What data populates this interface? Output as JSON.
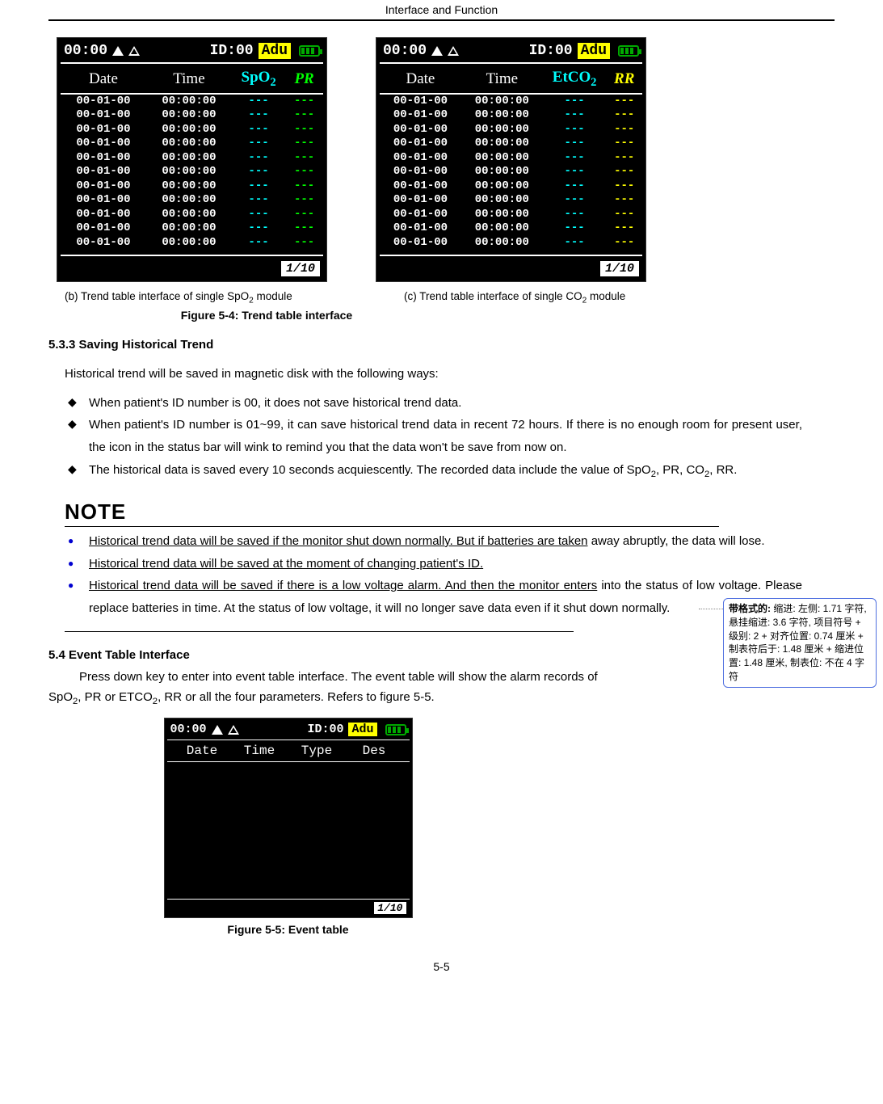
{
  "header": {
    "title": "Interface and Function"
  },
  "monitor_common": {
    "time": "00:00",
    "id_label": "ID:00",
    "adu": "Adu",
    "paging": "1/10",
    "row_date": "00-01-00",
    "row_time": "00:00:00",
    "dash": "---"
  },
  "monitor_left": {
    "headers": {
      "c1": "Date",
      "c2": "Time",
      "c3": "SpO",
      "c3sub": "2",
      "c4": "PR"
    },
    "row_count": 11
  },
  "monitor_right": {
    "headers": {
      "c1": "Date",
      "c2": "Time",
      "c3": "EtCO",
      "c3sub": "2",
      "c4": "RR"
    },
    "row_count": 11
  },
  "captions": {
    "left": "(b) Trend table interface of single SpO",
    "left_sub": "2",
    "left_tail": " module",
    "right": "(c) Trend table interface of single CO",
    "right_sub": "2",
    "right_tail": " module",
    "figure54": "Figure 5-4: Trend table interface"
  },
  "section533": {
    "heading": "5.3.3 Saving Historical Trend",
    "intro": "Historical trend will be saved in magnetic disk with the following ways:",
    "bullets": [
      "When patient's ID number is 00, it does not save historical trend data.",
      "When patient's ID number is 01~99, it can save historical trend data in recent 72 hours. If there is no enough room for present user, the icon in the status bar will wink to remind you that the data won't be save from now on.",
      "The historical data is saved every 10 seconds acquiescently. The recorded data include the value of SpO2, PR, CO2, RR."
    ],
    "note_label": "NOTE",
    "notes": [
      {
        "u": "Historical trend data will be saved if the monitor shut down normally. But if batteries are taken",
        "rest": "away abruptly, the data will lose."
      },
      {
        "u": "Historical trend data will be saved at the moment of changing patient's ID.",
        "rest": ""
      },
      {
        "u": "Historical trend data will be saved if there is a low voltage alarm. And then the monitor enters",
        "rest": "into the status of low voltage. Please replace batteries in time. At the status of low voltage, it will no longer save data even if it shut down normally."
      }
    ]
  },
  "section54": {
    "heading": "5.4 Event Table Interface",
    "line1": "Press down key to enter into event table interface. The event table will show the alarm records of",
    "line2_pre": "SpO",
    "line2_sub1": "2",
    "line2_mid": ", PR or ETCO",
    "line2_sub2": "2",
    "line2_tail": ", RR or all the four parameters. Refers to figure 5-5."
  },
  "event_monitor": {
    "headers": {
      "c1": "Date",
      "c2": "Time",
      "c3": "Type",
      "c4": "Des"
    },
    "paging": "1/10"
  },
  "fig55": "Figure 5-5: Event table",
  "page_number": "5-5",
  "comment": {
    "label": "带格式的:",
    "text": " 缩进: 左侧: 1.71 字符, 悬挂缩进: 3.6 字符, 项目符号 + 级别: 2 + 对齐位置:  0.74 厘米 + 制表符后于:  1.48 厘米 + 缩进位置:  1.48 厘米, 制表位: 不在  4 字符"
  }
}
